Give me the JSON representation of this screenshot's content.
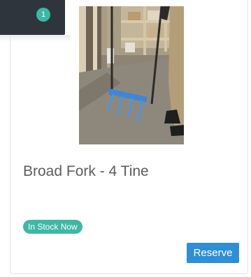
{
  "cart": {
    "count": "1"
  },
  "product": {
    "image_alt": "Broad fork with four blue tines standing on a shed floor",
    "title": "Broad Fork - 4 Tine",
    "stock_status": "In Stock Now",
    "reserve_label": "Reserve"
  },
  "colors": {
    "cart_tab": "#2f353d",
    "badge": "#3cb8a6",
    "stock_badge": "#3db8a5",
    "reserve_button": "#2e8fd6",
    "title_text": "#5d5d5d"
  }
}
